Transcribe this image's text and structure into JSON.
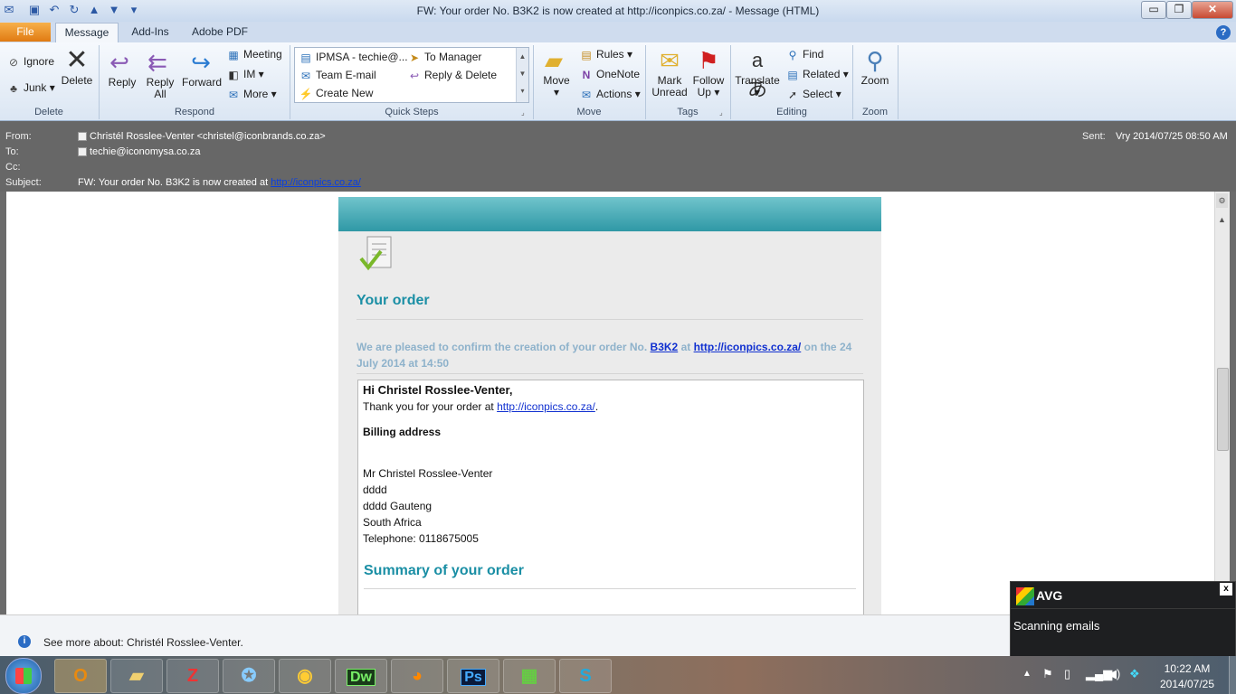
{
  "window": {
    "title": "FW: Your order No. B3K2 is now created at http://iconpics.co.za/  -  Message (HTML)",
    "minimize": "▭",
    "maximize": "❐",
    "close": "✕",
    "help": "?"
  },
  "tabs": [
    {
      "label": "File"
    },
    {
      "label": "Message"
    },
    {
      "label": "Add-Ins"
    },
    {
      "label": "Adobe PDF"
    }
  ],
  "ribbon": {
    "delete_group": {
      "label": "Delete",
      "ignore": "Ignore",
      "junk": "Junk",
      "delete": "Delete"
    },
    "respond_group": {
      "label": "Respond",
      "reply": "Reply",
      "reply_all_1": "Reply",
      "reply_all_2": "All",
      "forward": "Forward",
      "meeting": "Meeting",
      "im": "IM",
      "more": "More"
    },
    "quicksteps_group": {
      "label": "Quick Steps",
      "items": [
        "IPMSA - techie@...",
        "To Manager",
        "Team E-mail",
        "Reply & Delete",
        "Create New"
      ]
    },
    "move_group": {
      "label": "Move",
      "move": "Move",
      "rules": "Rules",
      "onenote": "OneNote",
      "actions": "Actions"
    },
    "tags_group": {
      "label": "Tags",
      "mark_unread_1": "Mark",
      "mark_unread_2": "Unread",
      "follow_up_1": "Follow",
      "follow_up_2": "Up"
    },
    "editing_group": {
      "label": "Editing",
      "translate": "Translate",
      "find": "Find",
      "related": "Related",
      "select": "Select"
    },
    "zoom_group": {
      "label": "Zoom",
      "zoom": "Zoom"
    }
  },
  "header": {
    "from_label": "From:",
    "from_value": "Christél Rosslee-Venter <christel@iconbrands.co.za>",
    "to_label": "To:",
    "to_value": "techie@iconomysa.co.za",
    "cc_label": "Cc:",
    "subject_label": "Subject:",
    "subject_prefix": "FW: Your order No. B3K2 is now created at",
    "subject_link": "http://iconpics.co.za/",
    "sent_label": "Sent:",
    "sent_value": "Vry 2014/07/25 08:50 AM"
  },
  "email": {
    "heading": "Your order",
    "confirm_1": "We are pleased to confirm the creation of your order No.",
    "order_no": "B3K2",
    "confirm_at": "at",
    "confirm_link": "http://iconpics.co.za/",
    "confirm_2": "on the 24",
    "confirm_3": "July 2014 at 14:50",
    "greeting": "Hi Christel Rosslee-Venter,",
    "thanks_1": "Thank you for your order at",
    "thanks_link": "http://iconpics.co.za/",
    "thanks_end": ".",
    "billing_heading": "Billing address",
    "address": [
      "Mr Christel Rosslee-Venter",
      "dddd",
      "dddd Gauteng",
      "South Africa",
      "Telephone: 0118675005"
    ],
    "summary_heading": "Summary of your order"
  },
  "infobar": {
    "text": "See more about: Christél Rosslee-Venter."
  },
  "avg": {
    "brand": "AVG",
    "message": "Scanning emails",
    "close": "x"
  },
  "taskbar": {
    "apps": [
      "Outlook",
      "Explorer",
      "FileZilla",
      "Safari",
      "Chrome",
      "Dreamweaver",
      "Firefox",
      "Photoshop",
      "Excel",
      "Skype"
    ],
    "dw_label": "Dw",
    "ps_label": "Ps",
    "time": "10:22 AM",
    "date": "2014/07/25"
  }
}
